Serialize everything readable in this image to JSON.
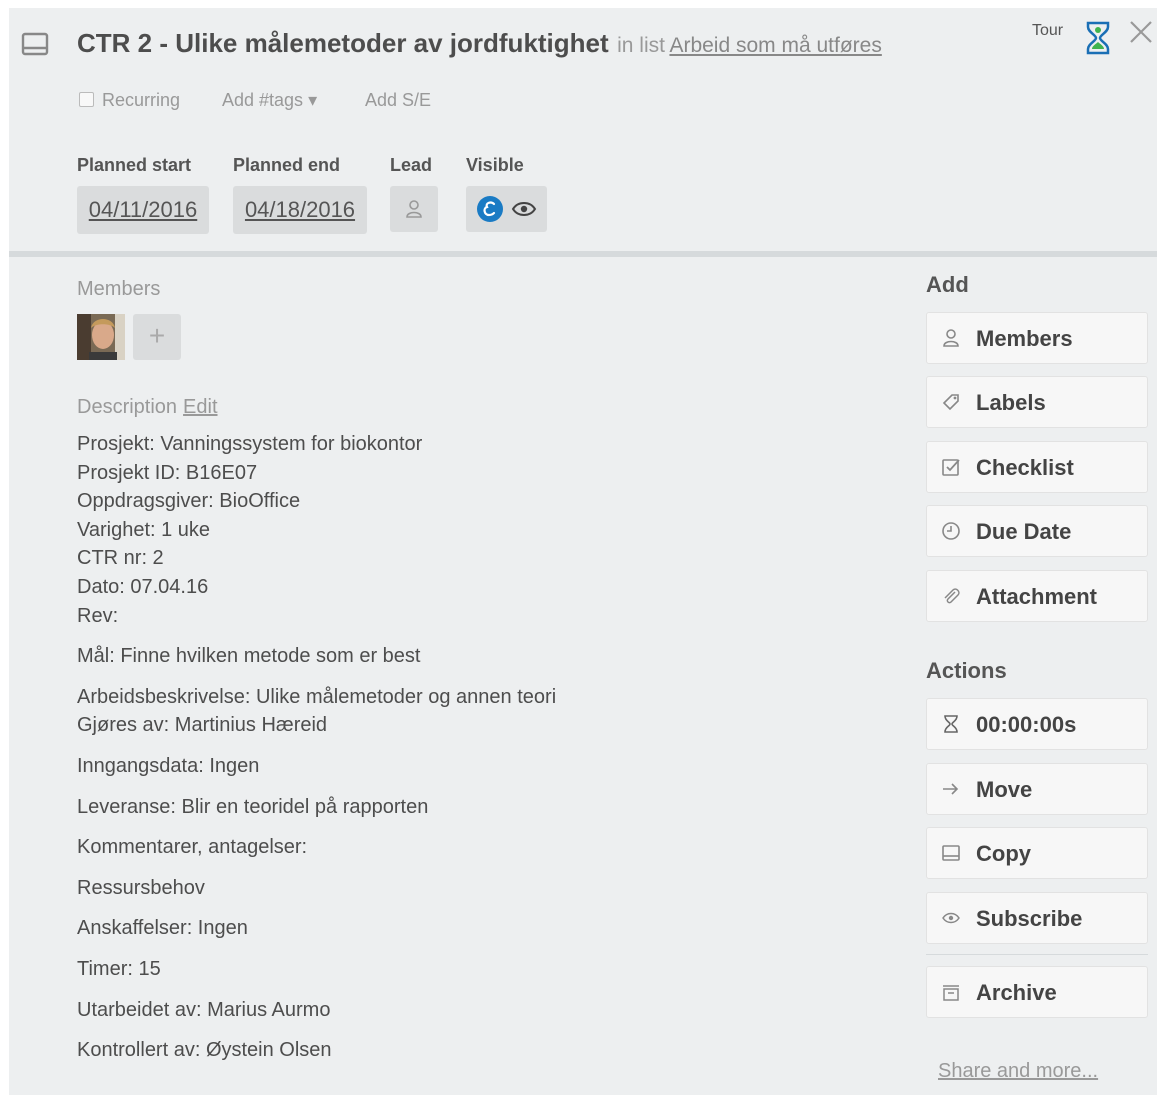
{
  "header": {
    "title": "CTR 2 - Ulike målemetoder av jordfuktighet",
    "in_list_prefix": "in list",
    "list_name": "Arbeid som må utføres",
    "tour_label": "Tour",
    "recurring_label": "Recurring",
    "add_tags_label": "Add #tags ▾",
    "add_se_label": "Add S/E"
  },
  "fields": {
    "planned_start_label": "Planned start",
    "planned_start_value": "04/11/2016",
    "planned_end_label": "Planned end",
    "planned_end_value": "04/18/2016",
    "lead_label": "Lead",
    "visible_label": "Visible"
  },
  "main": {
    "members_label": "Members",
    "add_member_symbol": "+",
    "description_label": "Description",
    "edit_label": "Edit",
    "description_lines": [
      "Prosjekt: Vanningssystem for biokontor",
      "Prosjekt ID: B16E07",
      "Oppdragsgiver: BioOffice",
      "Varighet: 1 uke",
      "CTR nr: 2",
      "Dato: 07.04.16",
      "Rev:",
      "Mål: Finne hvilken metode som er best",
      "Arbeidsbeskrivelse: Ulike målemetoder og annen teori",
      "Gjøres av: Martinius Hæreid",
      "Inngangsdata: Ingen",
      "Leveranse: Blir en teoridel på rapporten",
      "Kommentarer, antagelser:",
      "Ressursbehov",
      "Anskaffelser: Ingen",
      "Timer: 15",
      "Utarbeidet av: Marius Aurmo",
      "Kontrollert av: Øystein Olsen"
    ]
  },
  "sidebar": {
    "add_heading": "Add",
    "add_buttons": [
      {
        "label": "Members",
        "icon": "person-icon"
      },
      {
        "label": "Labels",
        "icon": "tag-icon"
      },
      {
        "label": "Checklist",
        "icon": "checklist-icon"
      },
      {
        "label": "Due Date",
        "icon": "clock-icon"
      },
      {
        "label": "Attachment",
        "icon": "paperclip-icon"
      }
    ],
    "actions_heading": "Actions",
    "action_buttons": [
      {
        "label": "00:00:00s",
        "icon": "hourglass-icon"
      },
      {
        "label": "Move",
        "icon": "arrow-right-icon"
      },
      {
        "label": "Copy",
        "icon": "card-icon"
      },
      {
        "label": "Subscribe",
        "icon": "eye-icon"
      },
      {
        "label": "Archive",
        "icon": "archive-icon"
      }
    ],
    "share_label": "Share and more..."
  },
  "colors": {
    "background": "#edeff0",
    "button": "#f7f7f7",
    "field_box": "#dadcdd",
    "accent_blue": "#1a7bc4"
  }
}
